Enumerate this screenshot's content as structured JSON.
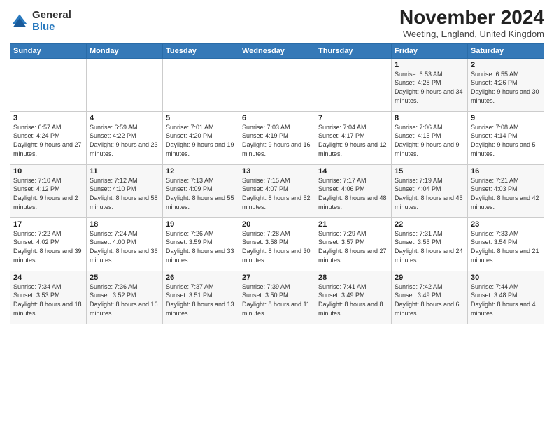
{
  "logo": {
    "general": "General",
    "blue": "Blue"
  },
  "title": "November 2024",
  "location": "Weeting, England, United Kingdom",
  "days_of_week": [
    "Sunday",
    "Monday",
    "Tuesday",
    "Wednesday",
    "Thursday",
    "Friday",
    "Saturday"
  ],
  "weeks": [
    [
      {
        "day": "",
        "info": ""
      },
      {
        "day": "",
        "info": ""
      },
      {
        "day": "",
        "info": ""
      },
      {
        "day": "",
        "info": ""
      },
      {
        "day": "",
        "info": ""
      },
      {
        "day": "1",
        "info": "Sunrise: 6:53 AM\nSunset: 4:28 PM\nDaylight: 9 hours and 34 minutes."
      },
      {
        "day": "2",
        "info": "Sunrise: 6:55 AM\nSunset: 4:26 PM\nDaylight: 9 hours and 30 minutes."
      }
    ],
    [
      {
        "day": "3",
        "info": "Sunrise: 6:57 AM\nSunset: 4:24 PM\nDaylight: 9 hours and 27 minutes."
      },
      {
        "day": "4",
        "info": "Sunrise: 6:59 AM\nSunset: 4:22 PM\nDaylight: 9 hours and 23 minutes."
      },
      {
        "day": "5",
        "info": "Sunrise: 7:01 AM\nSunset: 4:20 PM\nDaylight: 9 hours and 19 minutes."
      },
      {
        "day": "6",
        "info": "Sunrise: 7:03 AM\nSunset: 4:19 PM\nDaylight: 9 hours and 16 minutes."
      },
      {
        "day": "7",
        "info": "Sunrise: 7:04 AM\nSunset: 4:17 PM\nDaylight: 9 hours and 12 minutes."
      },
      {
        "day": "8",
        "info": "Sunrise: 7:06 AM\nSunset: 4:15 PM\nDaylight: 9 hours and 9 minutes."
      },
      {
        "day": "9",
        "info": "Sunrise: 7:08 AM\nSunset: 4:14 PM\nDaylight: 9 hours and 5 minutes."
      }
    ],
    [
      {
        "day": "10",
        "info": "Sunrise: 7:10 AM\nSunset: 4:12 PM\nDaylight: 9 hours and 2 minutes."
      },
      {
        "day": "11",
        "info": "Sunrise: 7:12 AM\nSunset: 4:10 PM\nDaylight: 8 hours and 58 minutes."
      },
      {
        "day": "12",
        "info": "Sunrise: 7:13 AM\nSunset: 4:09 PM\nDaylight: 8 hours and 55 minutes."
      },
      {
        "day": "13",
        "info": "Sunrise: 7:15 AM\nSunset: 4:07 PM\nDaylight: 8 hours and 52 minutes."
      },
      {
        "day": "14",
        "info": "Sunrise: 7:17 AM\nSunset: 4:06 PM\nDaylight: 8 hours and 48 minutes."
      },
      {
        "day": "15",
        "info": "Sunrise: 7:19 AM\nSunset: 4:04 PM\nDaylight: 8 hours and 45 minutes."
      },
      {
        "day": "16",
        "info": "Sunrise: 7:21 AM\nSunset: 4:03 PM\nDaylight: 8 hours and 42 minutes."
      }
    ],
    [
      {
        "day": "17",
        "info": "Sunrise: 7:22 AM\nSunset: 4:02 PM\nDaylight: 8 hours and 39 minutes."
      },
      {
        "day": "18",
        "info": "Sunrise: 7:24 AM\nSunset: 4:00 PM\nDaylight: 8 hours and 36 minutes."
      },
      {
        "day": "19",
        "info": "Sunrise: 7:26 AM\nSunset: 3:59 PM\nDaylight: 8 hours and 33 minutes."
      },
      {
        "day": "20",
        "info": "Sunrise: 7:28 AM\nSunset: 3:58 PM\nDaylight: 8 hours and 30 minutes."
      },
      {
        "day": "21",
        "info": "Sunrise: 7:29 AM\nSunset: 3:57 PM\nDaylight: 8 hours and 27 minutes."
      },
      {
        "day": "22",
        "info": "Sunrise: 7:31 AM\nSunset: 3:55 PM\nDaylight: 8 hours and 24 minutes."
      },
      {
        "day": "23",
        "info": "Sunrise: 7:33 AM\nSunset: 3:54 PM\nDaylight: 8 hours and 21 minutes."
      }
    ],
    [
      {
        "day": "24",
        "info": "Sunrise: 7:34 AM\nSunset: 3:53 PM\nDaylight: 8 hours and 18 minutes."
      },
      {
        "day": "25",
        "info": "Sunrise: 7:36 AM\nSunset: 3:52 PM\nDaylight: 8 hours and 16 minutes."
      },
      {
        "day": "26",
        "info": "Sunrise: 7:37 AM\nSunset: 3:51 PM\nDaylight: 8 hours and 13 minutes."
      },
      {
        "day": "27",
        "info": "Sunrise: 7:39 AM\nSunset: 3:50 PM\nDaylight: 8 hours and 11 minutes."
      },
      {
        "day": "28",
        "info": "Sunrise: 7:41 AM\nSunset: 3:49 PM\nDaylight: 8 hours and 8 minutes."
      },
      {
        "day": "29",
        "info": "Sunrise: 7:42 AM\nSunset: 3:49 PM\nDaylight: 8 hours and 6 minutes."
      },
      {
        "day": "30",
        "info": "Sunrise: 7:44 AM\nSunset: 3:48 PM\nDaylight: 8 hours and 4 minutes."
      }
    ]
  ]
}
